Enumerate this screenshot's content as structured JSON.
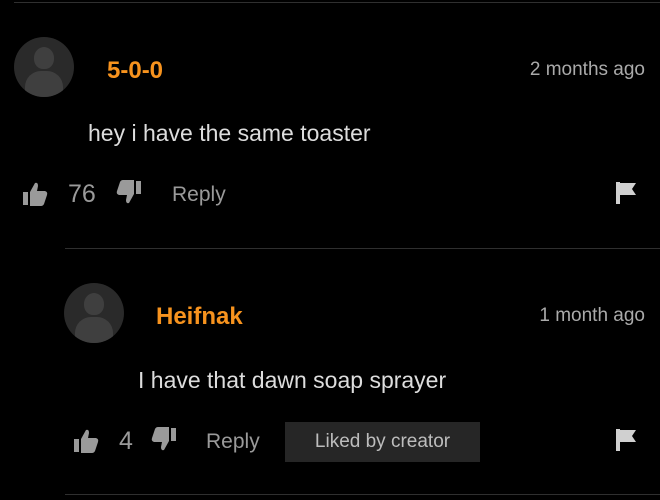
{
  "comments": [
    {
      "username": "5-0-0",
      "time": "2 months ago",
      "text": "hey i have the same toaster",
      "likes": "76",
      "reply_label": "Reply"
    },
    {
      "username": "Heifnak",
      "time": "1 month ago",
      "text": "I have that dawn soap sprayer",
      "likes": "4",
      "reply_label": "Reply",
      "badge": "Liked by creator"
    }
  ],
  "colors": {
    "username": "#f7931e",
    "background": "#000000",
    "badge_bg": "#262626"
  },
  "icons": [
    "avatar-icon",
    "thumbs-up-icon",
    "thumbs-down-icon",
    "flag-icon"
  ]
}
